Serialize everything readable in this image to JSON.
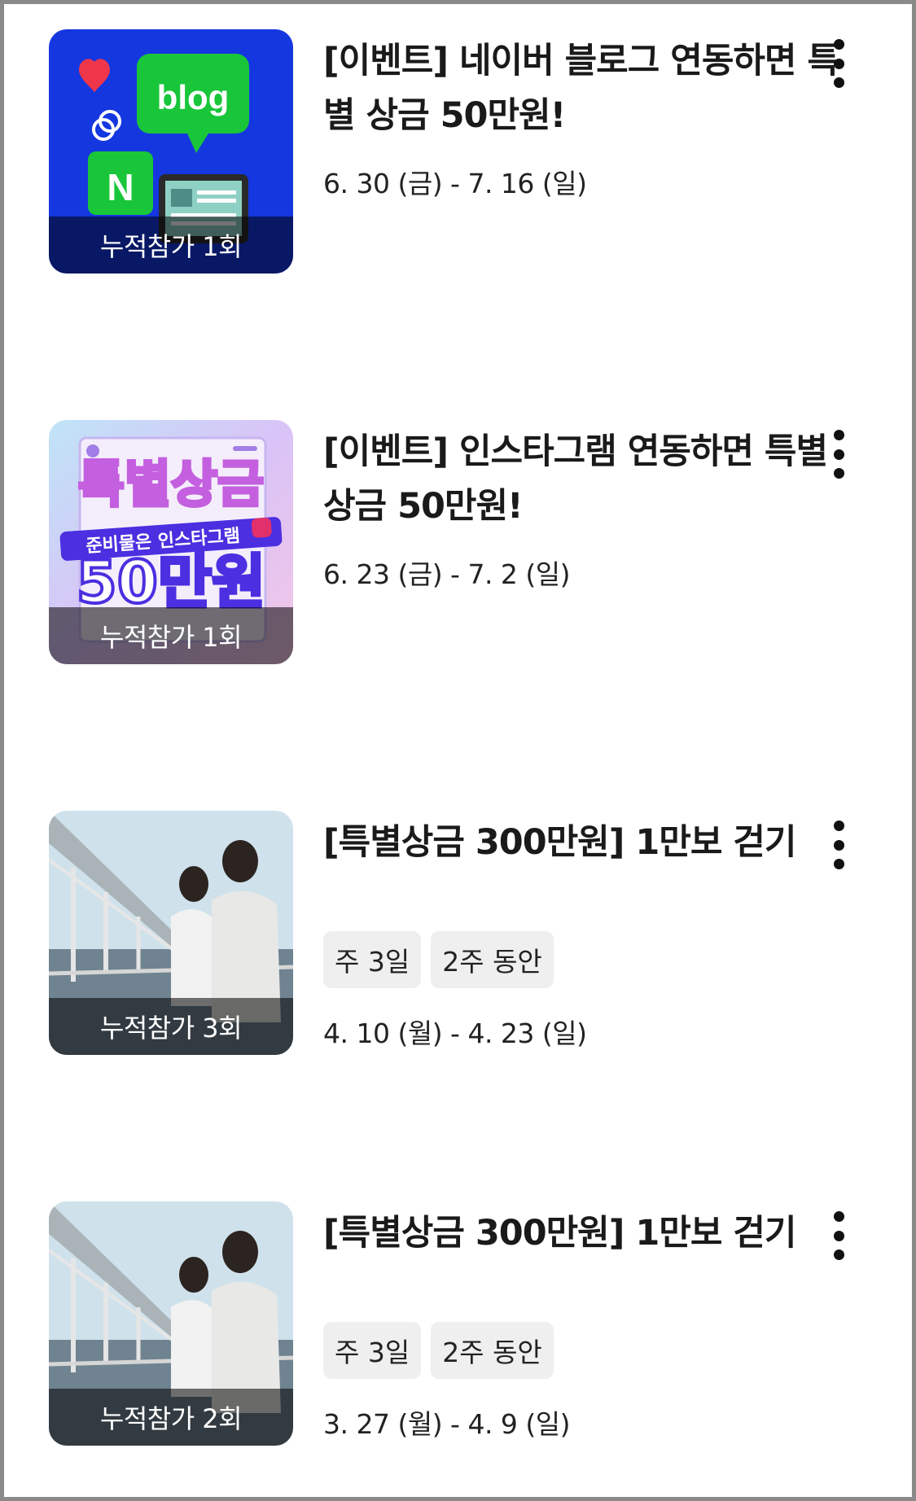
{
  "events": [
    {
      "thumb_label": "누적참가 1회",
      "title": "[이벤트] 네이버 블로그 연동하면 특별 상금 50만원!",
      "date": "6. 30 (금) - 7. 16 (일)",
      "image_text": "blog",
      "image_text2": "N"
    },
    {
      "thumb_label": "누적참가 1회",
      "title": "[이벤트] 인스타그램 연동하면 특별 상금 50만원!",
      "date": "6. 23 (금) - 7. 2 (일)",
      "image_text": "특별상금",
      "image_text2": "준비물은 인스타그램",
      "image_text3": "50만원"
    },
    {
      "thumb_label": "누적참가 3회",
      "title": "[특별상금 300만원] 1만보 걷기",
      "tags": [
        "주 3일",
        "2주 동안"
      ],
      "date": "4. 10 (월) - 4. 23 (일)"
    },
    {
      "thumb_label": "누적참가 2회",
      "title": "[특별상금 300만원] 1만보 걷기",
      "tags": [
        "주 3일",
        "2주 동안"
      ],
      "date": "3. 27 (월) - 4. 9 (일)"
    }
  ],
  "icons": {
    "more": "more-vertical-icon"
  },
  "colors": {
    "naver_blue": "#1537e0",
    "naver_green": "#19c63a",
    "promo_purple": "#d9c3f7"
  }
}
